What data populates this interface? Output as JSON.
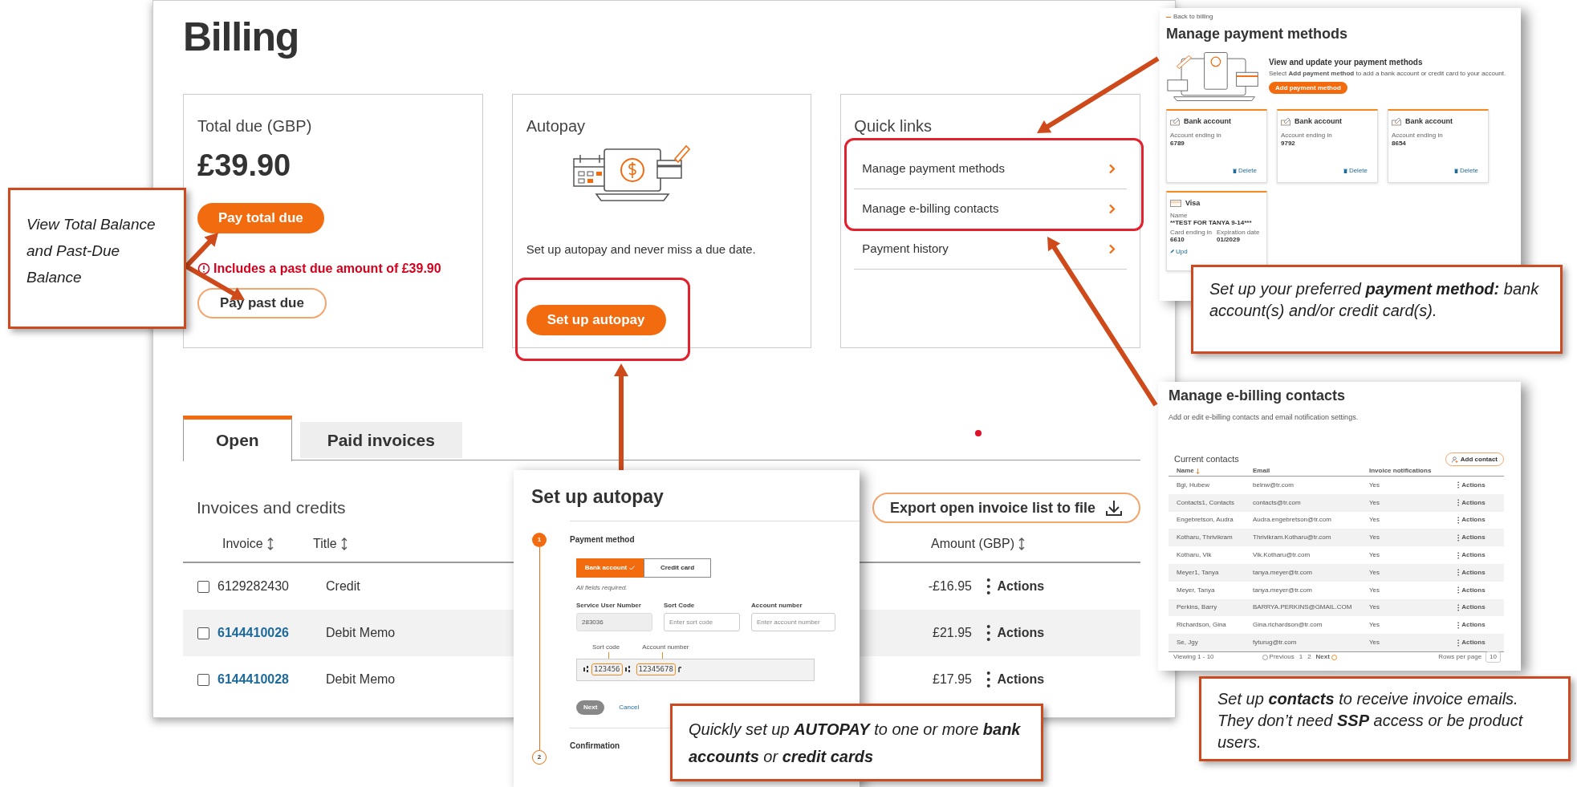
{
  "billing": {
    "title": "Billing",
    "total_due": {
      "label": "Total due (GBP)",
      "amount": "£39.90",
      "pay_button": "Pay total due",
      "warning": "Includes a past due amount of £39.90",
      "past_due_button": "Pay past due"
    },
    "autopay": {
      "label": "Autopay",
      "description": "Set up autopay and never miss a due date.",
      "button": "Set up autopay"
    },
    "quick_links": {
      "title": "Quick links",
      "items": [
        "Manage payment methods",
        "Manage e-billing contacts",
        "Payment history"
      ]
    },
    "tabs": [
      {
        "label": "Open",
        "selected": true
      },
      {
        "label": "Paid invoices",
        "selected": false
      }
    ],
    "invoices": {
      "title": "Invoices and credits",
      "export_button": "Export open invoice list to file",
      "columns": [
        "Invoice",
        "Title",
        "Amount (GBP)"
      ],
      "rows": [
        {
          "checked": false,
          "invoice": "6129282430",
          "link": false,
          "title": "Credit",
          "amount": "-£16.95",
          "actions": "Actions"
        },
        {
          "checked": false,
          "invoice": "6144410026",
          "link": true,
          "title": "Debit Memo",
          "amount": "£21.95",
          "actions": "Actions"
        },
        {
          "checked": false,
          "invoice": "6144410028",
          "link": true,
          "title": "Debit Memo",
          "amount": "£17.95",
          "actions": "Actions"
        }
      ]
    }
  },
  "payment_methods": {
    "back_link": "Back to billing",
    "title": "Manage payment methods",
    "intro_title": "View and update your payment methods",
    "intro_text": "Select **Add payment method** to add a bank account or credit card to your account.",
    "add_button": "Add payment method",
    "cards": [
      {
        "kind": "bank",
        "title": "Bank account",
        "fields": [
          {
            "label": "Account ending in",
            "value": "6789"
          }
        ],
        "action": "Delete"
      },
      {
        "kind": "bank",
        "title": "Bank account",
        "fields": [
          {
            "label": "Account ending in",
            "value": "9792"
          }
        ],
        "action": "Delete"
      },
      {
        "kind": "bank",
        "title": "Bank account",
        "fields": [
          {
            "label": "Account ending in",
            "value": "8654"
          }
        ],
        "action": "Delete"
      },
      {
        "kind": "card",
        "title": "Visa",
        "fields": [
          {
            "label": "Name",
            "value": "**TEST FOR TANYA 9-14***"
          },
          {
            "label": "Card ending in",
            "value": "6610"
          },
          {
            "label": "Expiration date",
            "value": "01/2029"
          }
        ],
        "action": "Upd"
      }
    ]
  },
  "contacts": {
    "title": "Manage e-billing contacts",
    "subtitle": "Add or edit e-billing contacts and email notification settings.",
    "section_title": "Current contacts",
    "add_button": "Add contact",
    "columns": [
      "Name",
      "Email",
      "Invoice notifications"
    ],
    "rows": [
      {
        "name": "Bgi, Hubew",
        "email": "belnw@tr.com",
        "notifications": "Yes",
        "actions": "Actions"
      },
      {
        "name": "Contacts1, Contacts",
        "email": "contacts@tr.com",
        "notifications": "Yes",
        "actions": "Actions"
      },
      {
        "name": "Engebretson, Audra",
        "email": "Audra.engebretson@tr.com",
        "notifications": "Yes",
        "actions": "Actions"
      },
      {
        "name": "Kotharu, Thrivikram",
        "email": "Thrivikram.Kotharu@tr.com",
        "notifications": "Yes",
        "actions": "Actions"
      },
      {
        "name": "Kotharu, Vik",
        "email": "Vik.Kotharu@tr.com",
        "notifications": "Yes",
        "actions": "Actions"
      },
      {
        "name": "Meyer1, Tanya",
        "email": "tanya.meyer@tr.com",
        "notifications": "Yes",
        "actions": "Actions"
      },
      {
        "name": "Meyer, Tanya",
        "email": "tanya.meyer@tr.com",
        "notifications": "Yes",
        "actions": "Actions"
      },
      {
        "name": "Perkins, Barry",
        "email": "BARRYA.PERKINS@GMAIL.COM",
        "notifications": "Yes",
        "actions": "Actions"
      },
      {
        "name": "Richardson, Gina",
        "email": "Gina.richardson@tr.com",
        "notifications": "Yes",
        "actions": "Actions"
      },
      {
        "name": "Se, Jgy",
        "email": "fyturug@tr.com",
        "notifications": "Yes",
        "actions": "Actions"
      }
    ],
    "footer": {
      "viewing": "Viewing 1 - 10",
      "previous": "Previous",
      "pages": [
        "1",
        "2"
      ],
      "next": "Next",
      "rows_per_page": "Rows per page",
      "rows_value": "10"
    }
  },
  "autopay_dialog": {
    "title": "Set up autopay",
    "steps": [
      {
        "number": "1",
        "title": "Payment method",
        "active": true
      },
      {
        "number": "2",
        "title": "Confirmation",
        "active": false
      }
    ],
    "method_tabs": [
      {
        "label": "Bank account",
        "selected": true
      },
      {
        "label": "Credit card",
        "selected": false
      }
    ],
    "required_note": "All fields required.",
    "fields": [
      {
        "label": "Service User Number",
        "value": "283036",
        "disabled": true
      },
      {
        "label": "Sort Code",
        "placeholder": "Enter sort code",
        "disabled": false
      },
      {
        "label": "Account number",
        "placeholder": "Enter account number",
        "disabled": false
      }
    ],
    "cheque": {
      "sort_label": "Sort code",
      "account_label": "Account number",
      "sort_code": "123456",
      "account_number": "12345678"
    },
    "next_button": "Next",
    "cancel_link": "Cancel"
  },
  "callouts": [
    {
      "text": "View Total Balance and Past-Due Balance"
    },
    {
      "text": " Set up your preferred **payment method:**  bank account(s) and/or credit card(s)."
    },
    {
      "text": "Quickly set up **AUTOPAY** to one or more **bank accounts** or **credit cards**"
    },
    {
      "text": " Set up **contacts** to receive invoice emails. They don’t need **SSP** access or be product users."
    }
  ]
}
